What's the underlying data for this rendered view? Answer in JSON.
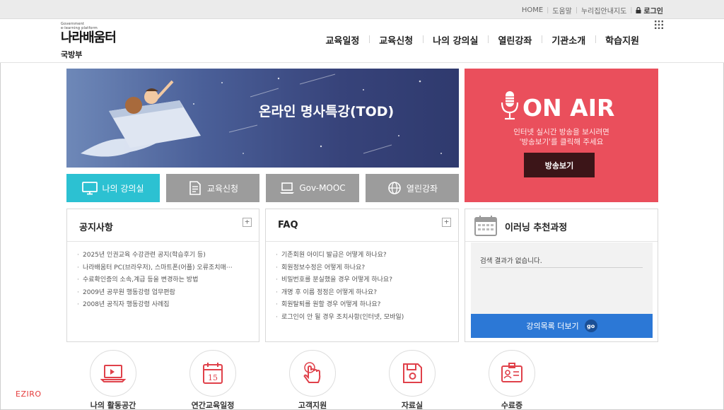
{
  "util_links": [
    "HOME",
    "도움말",
    "누리집안내지도"
  ],
  "login_label": "로그인",
  "logo": {
    "subtitle_line1": "Government",
    "subtitle_line2": "e-learning platform",
    "name": "나라배움터",
    "org": "국방부"
  },
  "nav": [
    "교육일정",
    "교육신청",
    "나의 강의실",
    "열린강좌",
    "기관소개",
    "학습지원"
  ],
  "banner": {
    "title": "온라인 명사특강(TOD)"
  },
  "onair": {
    "title": "ON AIR",
    "desc_line1": "인터넷 실시간 방송을 보시려면",
    "desc_line2": "'방송보기'를 클릭해 주세요",
    "button": "방송보기"
  },
  "quick_buttons": [
    {
      "label": "나의 강의실",
      "icon": "monitor-icon"
    },
    {
      "label": "교육신청",
      "icon": "document-icon"
    },
    {
      "label": "Gov-MOOC",
      "icon": "laptop-icon"
    },
    {
      "label": "열린강좌",
      "icon": "globe-icon"
    }
  ],
  "notices": {
    "title": "공지사항",
    "items": [
      "2025년 인권교육 수강관련 공지(학습후기 등)",
      "나라배움터 PC(브라우저), 스마트폰(어플) 오류조치매⋯",
      "수료확인증의 소속,계급 등을 변경하는 방법",
      "2009년 공무원 행동강령 업무편람",
      "2008년 공직자 행동강령 사례집"
    ]
  },
  "faq": {
    "title": "FAQ",
    "items": [
      "기존회원 아이디 발급은 어떻게 하나요?",
      "회원정보수정은 어떻게 하나요?",
      "비밀번호를 분실했을 경우 어떻게 하나요?",
      "개명 후 이름 정정은 어떻게 하나요?",
      "회원탈퇴를 원할 경우 어떻게 하나요?",
      "로그인이 안 될 경우 조치사항(인터넷, 모바일)"
    ]
  },
  "recommend": {
    "title": "이러닝 추천과정",
    "empty": "검색 결과가 없습니다.",
    "button": "강의목록 더보기",
    "go": "go"
  },
  "bottom_icons": [
    {
      "label": "나의 활동공간",
      "icon": "laptop-icon"
    },
    {
      "label": "연간교육일정",
      "icon": "calendar-icon"
    },
    {
      "label": "고객지원",
      "icon": "hand-pointer-icon"
    },
    {
      "label": "자료실",
      "icon": "floppy-disk-icon"
    },
    {
      "label": "수료증",
      "icon": "certificate-icon"
    }
  ],
  "brand": "EZIRO",
  "colors": {
    "accent_cyan": "#2cc1d2",
    "onair_red": "#ea4f5c",
    "button_blue": "#2c78d6",
    "icon_red": "#e0414a"
  }
}
